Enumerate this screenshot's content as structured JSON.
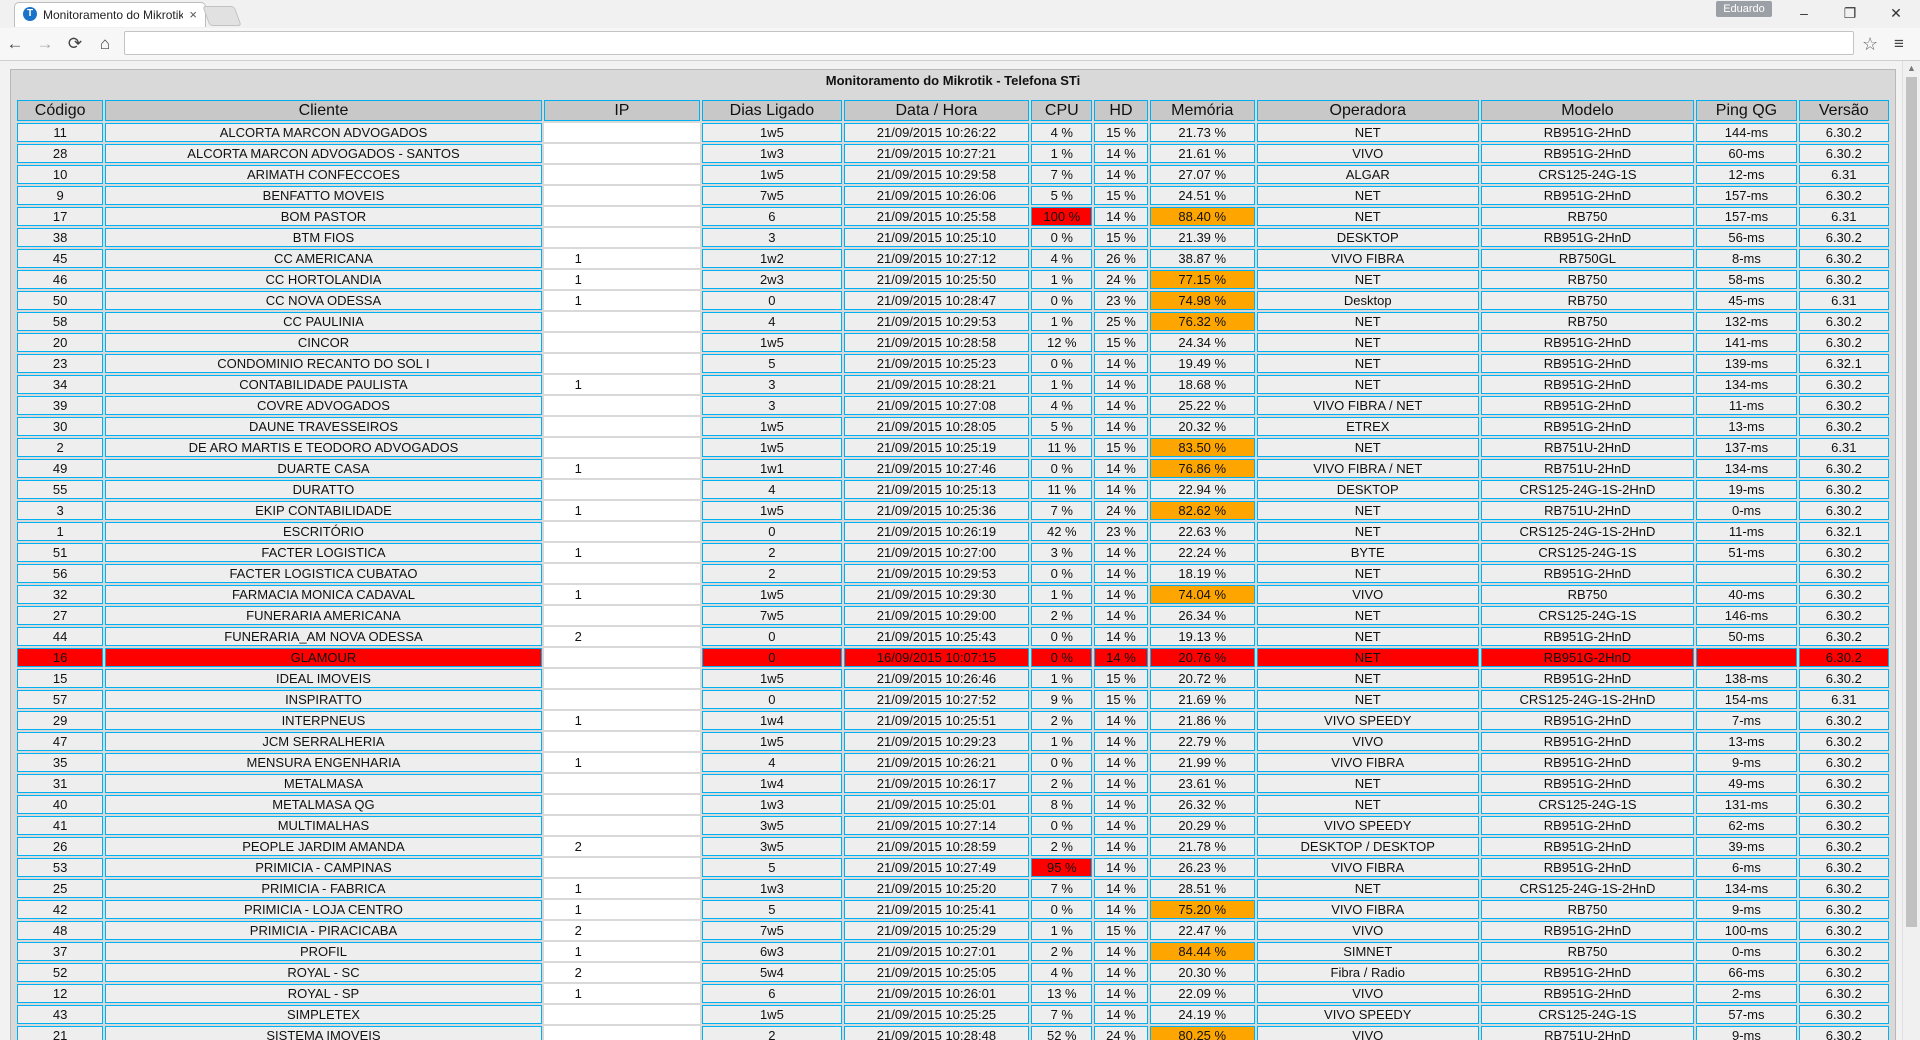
{
  "browser": {
    "tab_title": "Monitoramento do Mikrotik",
    "tab_favicon": "T",
    "tab_close": "×",
    "user": "Eduardo",
    "url": "",
    "window_buttons": [
      "–",
      "❐",
      "✕"
    ],
    "nav_icons": {
      "back": "←",
      "forward": "→",
      "reload": "⟳",
      "home": "⌂",
      "star": "☆",
      "menu": "≡"
    }
  },
  "page": {
    "title": "Monitoramento do Mikrotik - Telefona STi",
    "columns": [
      "Código",
      "Cliente",
      "IP",
      "Dias Ligado",
      "Data / Hora",
      "CPU",
      "HD",
      "Memória",
      "Operadora",
      "Modelo",
      "Ping QG",
      "Versão"
    ],
    "rows": [
      {
        "codigo": "11",
        "cliente": "ALCORTA MARCON ADVOGADOS",
        "ip": "",
        "dias": "1w5",
        "data": "21/09/2015 10:26:22",
        "cpu": "4 %",
        "hd": "15 %",
        "mem": "21.73 %",
        "operadora": "NET",
        "modelo": "RB951G-2HnD",
        "ping": "144-ms",
        "versao": "6.30.2",
        "cpu_alert": false,
        "mem_alert": false,
        "alert": false
      },
      {
        "codigo": "28",
        "cliente": "ALCORTA MARCON ADVOGADOS - SANTOS",
        "ip": "",
        "dias": "1w3",
        "data": "21/09/2015 10:27:21",
        "cpu": "1 %",
        "hd": "14 %",
        "mem": "21.61 %",
        "operadora": "VIVO",
        "modelo": "RB951G-2HnD",
        "ping": "60-ms",
        "versao": "6.30.2",
        "cpu_alert": false,
        "mem_alert": false,
        "alert": false
      },
      {
        "codigo": "10",
        "cliente": "ARIMATH CONFECCOES",
        "ip": "",
        "dias": "1w5",
        "data": "21/09/2015 10:29:58",
        "cpu": "7 %",
        "hd": "14 %",
        "mem": "27.07 %",
        "operadora": "ALGAR",
        "modelo": "CRS125-24G-1S",
        "ping": "12-ms",
        "versao": "6.31",
        "cpu_alert": false,
        "mem_alert": false,
        "alert": false
      },
      {
        "codigo": "9",
        "cliente": "BENFATTO MOVEIS",
        "ip": "",
        "dias": "7w5",
        "data": "21/09/2015 10:26:06",
        "cpu": "5 %",
        "hd": "15 %",
        "mem": "24.51 %",
        "operadora": "NET",
        "modelo": "RB951G-2HnD",
        "ping": "157-ms",
        "versao": "6.30.2",
        "cpu_alert": false,
        "mem_alert": false,
        "alert": false
      },
      {
        "codigo": "17",
        "cliente": "BOM PASTOR",
        "ip": "",
        "dias": "6",
        "data": "21/09/2015 10:25:58",
        "cpu": "100 %",
        "hd": "14 %",
        "mem": "88.40 %",
        "operadora": "NET",
        "modelo": "RB750",
        "ping": "157-ms",
        "versao": "6.31",
        "cpu_alert": true,
        "mem_alert": true,
        "alert": false
      },
      {
        "codigo": "38",
        "cliente": "BTM FIOS",
        "ip": "",
        "dias": "3",
        "data": "21/09/2015 10:25:10",
        "cpu": "0 %",
        "hd": "15 %",
        "mem": "21.39 %",
        "operadora": "DESKTOP",
        "modelo": "RB951G-2HnD",
        "ping": "56-ms",
        "versao": "6.30.2",
        "cpu_alert": false,
        "mem_alert": false,
        "alert": false
      },
      {
        "codigo": "45",
        "cliente": "CC AMERICANA",
        "ip": "1",
        "dias": "1w2",
        "data": "21/09/2015 10:27:12",
        "cpu": "4 %",
        "hd": "26 %",
        "mem": "38.87 %",
        "operadora": "VIVO FIBRA",
        "modelo": "RB750GL",
        "ping": "8-ms",
        "versao": "6.30.2",
        "cpu_alert": false,
        "mem_alert": false,
        "alert": false
      },
      {
        "codigo": "46",
        "cliente": "CC HORTOLANDIA",
        "ip": "1",
        "dias": "2w3",
        "data": "21/09/2015 10:25:50",
        "cpu": "1 %",
        "hd": "24 %",
        "mem": "77.15 %",
        "operadora": "NET",
        "modelo": "RB750",
        "ping": "58-ms",
        "versao": "6.30.2",
        "cpu_alert": false,
        "mem_alert": true,
        "alert": false
      },
      {
        "codigo": "50",
        "cliente": "CC NOVA ODESSA",
        "ip": "1",
        "dias": "0",
        "data": "21/09/2015 10:28:47",
        "cpu": "0 %",
        "hd": "23 %",
        "mem": "74.98 %",
        "operadora": "Desktop",
        "modelo": "RB750",
        "ping": "45-ms",
        "versao": "6.31",
        "cpu_alert": false,
        "mem_alert": true,
        "alert": false
      },
      {
        "codigo": "58",
        "cliente": "CC PAULINIA",
        "ip": "",
        "dias": "4",
        "data": "21/09/2015 10:29:53",
        "cpu": "1 %",
        "hd": "25 %",
        "mem": "76.32 %",
        "operadora": "NET",
        "modelo": "RB750",
        "ping": "132-ms",
        "versao": "6.30.2",
        "cpu_alert": false,
        "mem_alert": true,
        "alert": false
      },
      {
        "codigo": "20",
        "cliente": "CINCOR",
        "ip": "",
        "dias": "1w5",
        "data": "21/09/2015 10:28:58",
        "cpu": "12 %",
        "hd": "15 %",
        "mem": "24.34 %",
        "operadora": "NET",
        "modelo": "RB951G-2HnD",
        "ping": "141-ms",
        "versao": "6.30.2",
        "cpu_alert": false,
        "mem_alert": false,
        "alert": false
      },
      {
        "codigo": "23",
        "cliente": "CONDOMINIO RECANTO DO SOL I",
        "ip": "",
        "dias": "5",
        "data": "21/09/2015 10:25:23",
        "cpu": "0 %",
        "hd": "14 %",
        "mem": "19.49 %",
        "operadora": "NET",
        "modelo": "RB951G-2HnD",
        "ping": "139-ms",
        "versao": "6.32.1",
        "cpu_alert": false,
        "mem_alert": false,
        "alert": false
      },
      {
        "codigo": "34",
        "cliente": "CONTABILIDADE PAULISTA",
        "ip": "1",
        "dias": "3",
        "data": "21/09/2015 10:28:21",
        "cpu": "1 %",
        "hd": "14 %",
        "mem": "18.68 %",
        "operadora": "NET",
        "modelo": "RB951G-2HnD",
        "ping": "134-ms",
        "versao": "6.30.2",
        "cpu_alert": false,
        "mem_alert": false,
        "alert": false
      },
      {
        "codigo": "39",
        "cliente": "COVRE ADVOGADOS",
        "ip": "",
        "dias": "3",
        "data": "21/09/2015 10:27:08",
        "cpu": "4 %",
        "hd": "14 %",
        "mem": "25.22 %",
        "operadora": "VIVO FIBRA / NET",
        "modelo": "RB951G-2HnD",
        "ping": "11-ms",
        "versao": "6.30.2",
        "cpu_alert": false,
        "mem_alert": false,
        "alert": false
      },
      {
        "codigo": "30",
        "cliente": "DAUNE TRAVESSEIROS",
        "ip": "",
        "dias": "1w5",
        "data": "21/09/2015 10:28:05",
        "cpu": "5 %",
        "hd": "14 %",
        "mem": "20.32 %",
        "operadora": "ETREX",
        "modelo": "RB951G-2HnD",
        "ping": "13-ms",
        "versao": "6.30.2",
        "cpu_alert": false,
        "mem_alert": false,
        "alert": false
      },
      {
        "codigo": "2",
        "cliente": "DE ARO MARTIS E TEODORO ADVOGADOS",
        "ip": "",
        "dias": "1w5",
        "data": "21/09/2015 10:25:19",
        "cpu": "11 %",
        "hd": "15 %",
        "mem": "83.50 %",
        "operadora": "NET",
        "modelo": "RB751U-2HnD",
        "ping": "137-ms",
        "versao": "6.31",
        "cpu_alert": false,
        "mem_alert": true,
        "alert": false
      },
      {
        "codigo": "49",
        "cliente": "DUARTE CASA",
        "ip": "1",
        "dias": "1w1",
        "data": "21/09/2015 10:27:46",
        "cpu": "0 %",
        "hd": "14 %",
        "mem": "76.86 %",
        "operadora": "VIVO FIBRA / NET",
        "modelo": "RB751U-2HnD",
        "ping": "134-ms",
        "versao": "6.30.2",
        "cpu_alert": false,
        "mem_alert": true,
        "alert": false
      },
      {
        "codigo": "55",
        "cliente": "DURATTO",
        "ip": "",
        "dias": "4",
        "data": "21/09/2015 10:25:13",
        "cpu": "11 %",
        "hd": "14 %",
        "mem": "22.94 %",
        "operadora": "DESKTOP",
        "modelo": "CRS125-24G-1S-2HnD",
        "ping": "19-ms",
        "versao": "6.30.2",
        "cpu_alert": false,
        "mem_alert": false,
        "alert": false
      },
      {
        "codigo": "3",
        "cliente": "EKIP CONTABILIDADE",
        "ip": "1",
        "dias": "1w5",
        "data": "21/09/2015 10:25:36",
        "cpu": "7 %",
        "hd": "24 %",
        "mem": "82.62 %",
        "operadora": "NET",
        "modelo": "RB751U-2HnD",
        "ping": "0-ms",
        "versao": "6.30.2",
        "cpu_alert": false,
        "mem_alert": true,
        "alert": false
      },
      {
        "codigo": "1",
        "cliente": "ESCRITÓRIO",
        "ip": "",
        "dias": "0",
        "data": "21/09/2015 10:26:19",
        "cpu": "42 %",
        "hd": "23 %",
        "mem": "22.63 %",
        "operadora": "NET",
        "modelo": "CRS125-24G-1S-2HnD",
        "ping": "11-ms",
        "versao": "6.32.1",
        "cpu_alert": false,
        "mem_alert": false,
        "alert": false
      },
      {
        "codigo": "51",
        "cliente": "FACTER LOGISTICA",
        "ip": "1",
        "dias": "2",
        "data": "21/09/2015 10:27:00",
        "cpu": "3 %",
        "hd": "14 %",
        "mem": "22.24 %",
        "operadora": "BYTE",
        "modelo": "CRS125-24G-1S",
        "ping": "51-ms",
        "versao": "6.30.2",
        "cpu_alert": false,
        "mem_alert": false,
        "alert": false
      },
      {
        "codigo": "56",
        "cliente": "FACTER LOGISTICA CUBATAO",
        "ip": "",
        "dias": "2",
        "data": "21/09/2015 10:29:53",
        "cpu": "0 %",
        "hd": "14 %",
        "mem": "18.19 %",
        "operadora": "NET",
        "modelo": "RB951G-2HnD",
        "ping": "",
        "versao": "6.30.2",
        "cpu_alert": false,
        "mem_alert": false,
        "alert": false
      },
      {
        "codigo": "32",
        "cliente": "FARMACIA MONICA CADAVAL",
        "ip": "1",
        "dias": "1w5",
        "data": "21/09/2015 10:29:30",
        "cpu": "1 %",
        "hd": "14 %",
        "mem": "74.04 %",
        "operadora": "VIVO",
        "modelo": "RB750",
        "ping": "40-ms",
        "versao": "6.30.2",
        "cpu_alert": false,
        "mem_alert": true,
        "alert": false
      },
      {
        "codigo": "27",
        "cliente": "FUNERARIA AMERICANA",
        "ip": "",
        "dias": "7w5",
        "data": "21/09/2015 10:29:00",
        "cpu": "2 %",
        "hd": "14 %",
        "mem": "26.34 %",
        "operadora": "NET",
        "modelo": "CRS125-24G-1S",
        "ping": "146-ms",
        "versao": "6.30.2",
        "cpu_alert": false,
        "mem_alert": false,
        "alert": false
      },
      {
        "codigo": "44",
        "cliente": "FUNERARIA_AM NOVA ODESSA",
        "ip": "2",
        "dias": "0",
        "data": "21/09/2015 10:25:43",
        "cpu": "0 %",
        "hd": "14 %",
        "mem": "19.13 %",
        "operadora": "NET",
        "modelo": "RB951G-2HnD",
        "ping": "50-ms",
        "versao": "6.30.2",
        "cpu_alert": false,
        "mem_alert": false,
        "alert": false
      },
      {
        "codigo": "16",
        "cliente": "GLAMOUR",
        "ip": "",
        "dias": "0",
        "data": "16/09/2015 10:07:15",
        "cpu": "0 %",
        "hd": "14 %",
        "mem": "20.76 %",
        "operadora": "NET",
        "modelo": "RB951G-2HnD",
        "ping": "",
        "versao": "6.30.2",
        "cpu_alert": false,
        "mem_alert": false,
        "alert": true
      },
      {
        "codigo": "15",
        "cliente": "IDEAL IMOVEIS",
        "ip": "",
        "dias": "1w5",
        "data": "21/09/2015 10:26:46",
        "cpu": "1 %",
        "hd": "15 %",
        "mem": "20.72 %",
        "operadora": "NET",
        "modelo": "RB951G-2HnD",
        "ping": "138-ms",
        "versao": "6.30.2",
        "cpu_alert": false,
        "mem_alert": false,
        "alert": false
      },
      {
        "codigo": "57",
        "cliente": "INSPIRATTO",
        "ip": "",
        "dias": "0",
        "data": "21/09/2015 10:27:52",
        "cpu": "9 %",
        "hd": "15 %",
        "mem": "21.69 %",
        "operadora": "NET",
        "modelo": "CRS125-24G-1S-2HnD",
        "ping": "154-ms",
        "versao": "6.31",
        "cpu_alert": false,
        "mem_alert": false,
        "alert": false
      },
      {
        "codigo": "29",
        "cliente": "INTERPNEUS",
        "ip": "1",
        "dias": "1w4",
        "data": "21/09/2015 10:25:51",
        "cpu": "2 %",
        "hd": "14 %",
        "mem": "21.86 %",
        "operadora": "VIVO SPEEDY",
        "modelo": "RB951G-2HnD",
        "ping": "7-ms",
        "versao": "6.30.2",
        "cpu_alert": false,
        "mem_alert": false,
        "alert": false
      },
      {
        "codigo": "47",
        "cliente": "JCM SERRALHERIA",
        "ip": "",
        "dias": "1w5",
        "data": "21/09/2015 10:29:23",
        "cpu": "1 %",
        "hd": "14 %",
        "mem": "22.79 %",
        "operadora": "VIVO",
        "modelo": "RB951G-2HnD",
        "ping": "13-ms",
        "versao": "6.30.2",
        "cpu_alert": false,
        "mem_alert": false,
        "alert": false
      },
      {
        "codigo": "35",
        "cliente": "MENSURA ENGENHARIA",
        "ip": "1",
        "dias": "4",
        "data": "21/09/2015 10:26:21",
        "cpu": "0 %",
        "hd": "14 %",
        "mem": "21.99 %",
        "operadora": "VIVO FIBRA",
        "modelo": "RB951G-2HnD",
        "ping": "9-ms",
        "versao": "6.30.2",
        "cpu_alert": false,
        "mem_alert": false,
        "alert": false
      },
      {
        "codigo": "31",
        "cliente": "METALMASA",
        "ip": "",
        "dias": "1w4",
        "data": "21/09/2015 10:26:17",
        "cpu": "2 %",
        "hd": "14 %",
        "mem": "23.61 %",
        "operadora": "NET",
        "modelo": "RB951G-2HnD",
        "ping": "49-ms",
        "versao": "6.30.2",
        "cpu_alert": false,
        "mem_alert": false,
        "alert": false
      },
      {
        "codigo": "40",
        "cliente": "METALMASA QG",
        "ip": "",
        "dias": "1w3",
        "data": "21/09/2015 10:25:01",
        "cpu": "8 %",
        "hd": "14 %",
        "mem": "26.32 %",
        "operadora": "NET",
        "modelo": "CRS125-24G-1S",
        "ping": "131-ms",
        "versao": "6.30.2",
        "cpu_alert": false,
        "mem_alert": false,
        "alert": false
      },
      {
        "codigo": "41",
        "cliente": "MULTIMALHAS",
        "ip": "",
        "dias": "3w5",
        "data": "21/09/2015 10:27:14",
        "cpu": "0 %",
        "hd": "14 %",
        "mem": "20.29 %",
        "operadora": "VIVO SPEEDY",
        "modelo": "RB951G-2HnD",
        "ping": "62-ms",
        "versao": "6.30.2",
        "cpu_alert": false,
        "mem_alert": false,
        "alert": false
      },
      {
        "codigo": "26",
        "cliente": "PEOPLE JARDIM AMANDA",
        "ip": "2",
        "dias": "3w5",
        "data": "21/09/2015 10:28:59",
        "cpu": "2 %",
        "hd": "14 %",
        "mem": "21.78 %",
        "operadora": "DESKTOP / DESKTOP",
        "modelo": "RB951G-2HnD",
        "ping": "39-ms",
        "versao": "6.30.2",
        "cpu_alert": false,
        "mem_alert": false,
        "alert": false
      },
      {
        "codigo": "53",
        "cliente": "PRIMICIA - CAMPINAS",
        "ip": "",
        "dias": "5",
        "data": "21/09/2015 10:27:49",
        "cpu": "95 %",
        "hd": "14 %",
        "mem": "26.23 %",
        "operadora": "VIVO FIBRA",
        "modelo": "RB951G-2HnD",
        "ping": "6-ms",
        "versao": "6.30.2",
        "cpu_alert": true,
        "mem_alert": false,
        "alert": false
      },
      {
        "codigo": "25",
        "cliente": "PRIMICIA - FABRICA",
        "ip": "1",
        "dias": "1w3",
        "data": "21/09/2015 10:25:20",
        "cpu": "7 %",
        "hd": "14 %",
        "mem": "28.51 %",
        "operadora": "NET",
        "modelo": "CRS125-24G-1S-2HnD",
        "ping": "134-ms",
        "versao": "6.30.2",
        "cpu_alert": false,
        "mem_alert": false,
        "alert": false
      },
      {
        "codigo": "42",
        "cliente": "PRIMICIA - LOJA CENTRO",
        "ip": "1",
        "dias": "5",
        "data": "21/09/2015 10:25:41",
        "cpu": "0 %",
        "hd": "14 %",
        "mem": "75.20 %",
        "operadora": "VIVO FIBRA",
        "modelo": "RB750",
        "ping": "9-ms",
        "versao": "6.30.2",
        "cpu_alert": false,
        "mem_alert": true,
        "alert": false
      },
      {
        "codigo": "48",
        "cliente": "PRIMICIA - PIRACICABA",
        "ip": "2",
        "dias": "7w5",
        "data": "21/09/2015 10:25:29",
        "cpu": "1 %",
        "hd": "15 %",
        "mem": "22.47 %",
        "operadora": "VIVO",
        "modelo": "RB951G-2HnD",
        "ping": "100-ms",
        "versao": "6.30.2",
        "cpu_alert": false,
        "mem_alert": false,
        "alert": false
      },
      {
        "codigo": "37",
        "cliente": "PROFIL",
        "ip": "1",
        "dias": "6w3",
        "data": "21/09/2015 10:27:01",
        "cpu": "2 %",
        "hd": "14 %",
        "mem": "84.44 %",
        "operadora": "SIMNET",
        "modelo": "RB750",
        "ping": "0-ms",
        "versao": "6.30.2",
        "cpu_alert": false,
        "mem_alert": true,
        "alert": false
      },
      {
        "codigo": "52",
        "cliente": "ROYAL - SC",
        "ip": "2",
        "dias": "5w4",
        "data": "21/09/2015 10:25:05",
        "cpu": "4 %",
        "hd": "14 %",
        "mem": "20.30 %",
        "operadora": "Fibra / Radio",
        "modelo": "RB951G-2HnD",
        "ping": "66-ms",
        "versao": "6.30.2",
        "cpu_alert": false,
        "mem_alert": false,
        "alert": false
      },
      {
        "codigo": "12",
        "cliente": "ROYAL - SP",
        "ip": "1",
        "dias": "6",
        "data": "21/09/2015 10:26:01",
        "cpu": "13 %",
        "hd": "14 %",
        "mem": "22.09 %",
        "operadora": "VIVO",
        "modelo": "RB951G-2HnD",
        "ping": "2-ms",
        "versao": "6.30.2",
        "cpu_alert": false,
        "mem_alert": false,
        "alert": false
      },
      {
        "codigo": "43",
        "cliente": "SIMPLETEX",
        "ip": "",
        "dias": "1w5",
        "data": "21/09/2015 10:25:25",
        "cpu": "7 %",
        "hd": "14 %",
        "mem": "24.19 %",
        "operadora": "VIVO SPEEDY",
        "modelo": "CRS125-24G-1S",
        "ping": "57-ms",
        "versao": "6.30.2",
        "cpu_alert": false,
        "mem_alert": false,
        "alert": false
      },
      {
        "codigo": "21",
        "cliente": "SISTEMA IMOVEIS",
        "ip": "",
        "dias": "2",
        "data": "21/09/2015 10:28:48",
        "cpu": "52 %",
        "hd": "24 %",
        "mem": "80.25 %",
        "operadora": "VIVO",
        "modelo": "RB751U-2HnD",
        "ping": "9-ms",
        "versao": "6.30.2",
        "cpu_alert": false,
        "mem_alert": true,
        "alert": false
      }
    ]
  }
}
